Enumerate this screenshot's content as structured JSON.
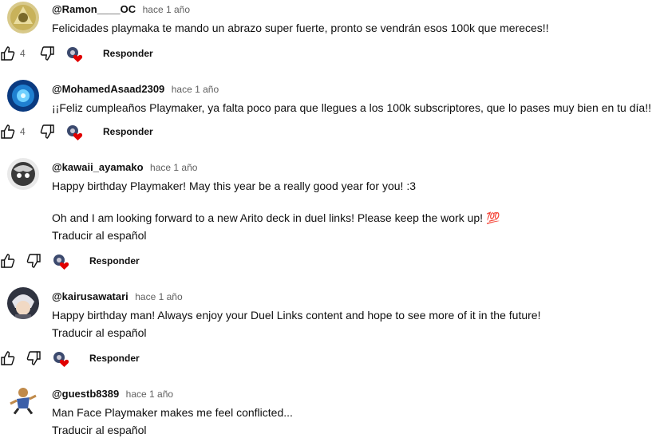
{
  "comments": [
    {
      "author": "@Ramon____OC",
      "time": "hace 1 año",
      "lines": [
        "Felicidades playmaka te mando un abrazo super fuerte, pronto se vendrán esos 100k que mereces!!"
      ],
      "likes": "4",
      "reply_label": "Responder",
      "avatar_color": "#c8b25a"
    },
    {
      "author": "@MohamedAsaad2309",
      "time": "hace 1 año",
      "lines": [
        "¡¡Feliz cumpleaños Playmaker, ya falta poco para que llegues a los 100k subscriptores, que lo pases muy bien en tu día!!"
      ],
      "likes": "4",
      "reply_label": "Responder",
      "avatar_color": "#1f7fd0"
    },
    {
      "author": "@kawaii_ayamako",
      "time": "hace 1 año",
      "lines": [
        "Happy birthday Playmaker! May this year be a really good year for you! :3",
        "",
        "Oh and I am looking forward to a new Arito deck in duel links! Please keep the work up! 💯"
      ],
      "translate_label": "Traducir al español",
      "reply_label": "Responder",
      "avatar_color": "#3a3a3a"
    },
    {
      "author": "@kairusawatari",
      "time": "hace 1 año",
      "lines": [
        "Happy birthday man! Always enjoy your Duel Links content and hope to see more of it in the future!"
      ],
      "translate_label": "Traducir al español",
      "reply_label": "Responder",
      "avatar_color": "#5a5a66"
    },
    {
      "author": "@guestb8389",
      "time": "hace 1 año",
      "lines": [
        "Man Face Playmaker makes me feel conflicted..."
      ],
      "translate_label": "Traducir al español",
      "avatar_color": "#3b5fa8"
    }
  ],
  "colors": {
    "heart": "#e00000",
    "secondary_text": "#606060"
  }
}
